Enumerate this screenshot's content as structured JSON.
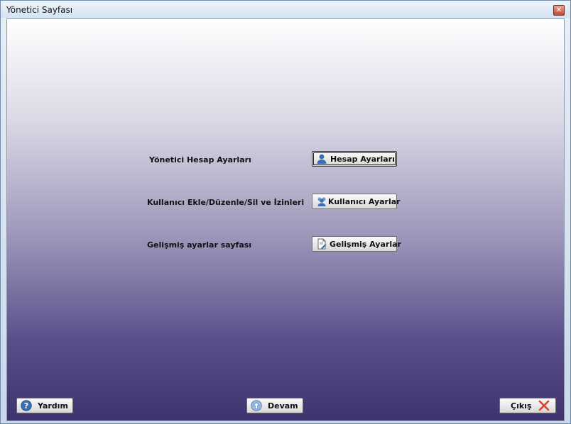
{
  "window": {
    "title": "Yönetici Sayfası",
    "close_label": "✕"
  },
  "rows": [
    {
      "label": "Yönetici Hesap Ayarları",
      "button": "Hesap Ayarları",
      "icon": "user-icon"
    },
    {
      "label": "Kullanıcı Ekle/Düzenle/Sil ve İzinleri",
      "button": "Kullanıcı Ayarlar",
      "icon": "users-icon"
    },
    {
      "label": "Gelişmiş ayarlar sayfası",
      "button": "Gelişmiş Ayarlar",
      "icon": "document-edit-icon"
    }
  ],
  "footer": {
    "help_label": "Yardım",
    "continue_label": "Devam",
    "exit_label": "Çıkış"
  },
  "colors": {
    "accent": "#3a6fb5",
    "exit_x": "#d9452b",
    "gradient_bottom": "#3f336f"
  }
}
